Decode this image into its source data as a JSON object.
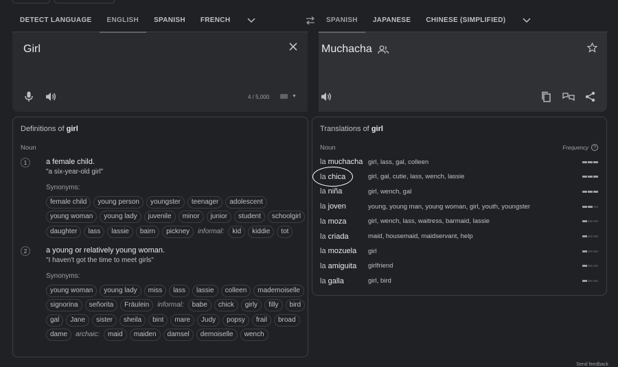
{
  "source_languages": [
    "DETECT LANGUAGE",
    "ENGLISH",
    "SPANISH",
    "FRENCH"
  ],
  "target_languages": [
    "SPANISH",
    "JAPANESE",
    "CHINESE (SIMPLIFIED)"
  ],
  "source": {
    "text": "Girl",
    "char_count": "4 / 5,000"
  },
  "target": {
    "text": "Muchacha"
  },
  "definitions": {
    "title_prefix": "Definitions of",
    "word": "girl",
    "pos": "Noun",
    "synonyms_label": "Synonyms:",
    "senses": [
      {
        "num": "1",
        "definition": "a female child.",
        "example": "\"a six-year-old girl\"",
        "rows": [
          [
            {
              "t": "chip",
              "v": "female child"
            },
            {
              "t": "chip",
              "v": "young person"
            },
            {
              "t": "chip",
              "v": "youngster"
            },
            {
              "t": "chip",
              "v": "teenager"
            },
            {
              "t": "chip",
              "v": "adolescent"
            }
          ],
          [
            {
              "t": "chip",
              "v": "young woman"
            },
            {
              "t": "chip",
              "v": "young lady"
            },
            {
              "t": "chip",
              "v": "juvenile"
            },
            {
              "t": "chip",
              "v": "minor"
            },
            {
              "t": "chip",
              "v": "junior"
            },
            {
              "t": "chip",
              "v": "student"
            },
            {
              "t": "chip",
              "v": "schoolgirl"
            }
          ],
          [
            {
              "t": "chip",
              "v": "daughter"
            },
            {
              "t": "chip",
              "v": "lass"
            },
            {
              "t": "chip",
              "v": "lassie"
            },
            {
              "t": "chip",
              "v": "bairn"
            },
            {
              "t": "chip",
              "v": "pickney"
            },
            {
              "t": "reg",
              "v": "informal:"
            },
            {
              "t": "chip",
              "v": "kid"
            },
            {
              "t": "chip",
              "v": "kiddie"
            },
            {
              "t": "chip",
              "v": "tot"
            }
          ]
        ]
      },
      {
        "num": "2",
        "definition": "a young or relatively young woman.",
        "example": "\"I haven't got the time to meet girls\"",
        "rows": [
          [
            {
              "t": "chip",
              "v": "young woman"
            },
            {
              "t": "chip",
              "v": "young lady"
            },
            {
              "t": "chip",
              "v": "miss"
            },
            {
              "t": "chip",
              "v": "lass"
            },
            {
              "t": "chip",
              "v": "lassie"
            },
            {
              "t": "chip",
              "v": "colleen"
            },
            {
              "t": "chip",
              "v": "mademoiselle"
            }
          ],
          [
            {
              "t": "chip",
              "v": "signorina"
            },
            {
              "t": "chip",
              "v": "señorita"
            },
            {
              "t": "chip",
              "v": "Fräulein"
            },
            {
              "t": "reg",
              "v": "informal:"
            },
            {
              "t": "chip",
              "v": "babe"
            },
            {
              "t": "chip",
              "v": "chick"
            },
            {
              "t": "chip",
              "v": "girly"
            },
            {
              "t": "chip",
              "v": "filly"
            },
            {
              "t": "chip",
              "v": "bird"
            }
          ],
          [
            {
              "t": "chip",
              "v": "gal"
            },
            {
              "t": "chip",
              "v": "Jane"
            },
            {
              "t": "chip",
              "v": "sister"
            },
            {
              "t": "chip",
              "v": "sheila"
            },
            {
              "t": "chip",
              "v": "bint"
            },
            {
              "t": "chip",
              "v": "mare"
            },
            {
              "t": "chip",
              "v": "Judy"
            },
            {
              "t": "chip",
              "v": "popsy"
            },
            {
              "t": "chip",
              "v": "frail"
            },
            {
              "t": "chip",
              "v": "broad"
            }
          ],
          [
            {
              "t": "chip",
              "v": "dame"
            },
            {
              "t": "reg",
              "v": "archaic:"
            },
            {
              "t": "chip",
              "v": "maid"
            },
            {
              "t": "chip",
              "v": "maiden"
            },
            {
              "t": "chip",
              "v": "damsel"
            },
            {
              "t": "chip",
              "v": "demoiselle"
            },
            {
              "t": "chip",
              "v": "wench"
            }
          ]
        ]
      }
    ]
  },
  "translations": {
    "title_prefix": "Translations of",
    "word": "girl",
    "pos": "Noun",
    "frequency_label": "Frequency",
    "rows": [
      {
        "article": "la",
        "word": "muchacha",
        "back": "girl, lass, gal, colleen",
        "freq": 3
      },
      {
        "article": "la",
        "word": "chica",
        "back": "girl, gal, cutie, lass, wench, lassie",
        "freq": 3
      },
      {
        "article": "la",
        "word": "niña",
        "back": "girl, wench, gal",
        "freq": 3
      },
      {
        "article": "la",
        "word": "joven",
        "back": "young, young man, young woman, girl, youth, youngster",
        "freq": 2
      },
      {
        "article": "la",
        "word": "moza",
        "back": "girl, wench, lass, waitress, barmaid, lassie",
        "freq": 1
      },
      {
        "article": "la",
        "word": "criada",
        "back": "maid, housemaid, maidservant, help",
        "freq": 1
      },
      {
        "article": "la",
        "word": "mozuela",
        "back": "girl",
        "freq": 1
      },
      {
        "article": "la",
        "word": "amiguita",
        "back": "girlfriend",
        "freq": 1
      },
      {
        "article": "la",
        "word": "galla",
        "back": "girl, bird",
        "freq": 1
      }
    ]
  },
  "footer": {
    "note": "Send feedback"
  },
  "colors": {
    "background": "#202124",
    "panel": "#2a2b2e",
    "annotation_circle": "#ffffff"
  }
}
